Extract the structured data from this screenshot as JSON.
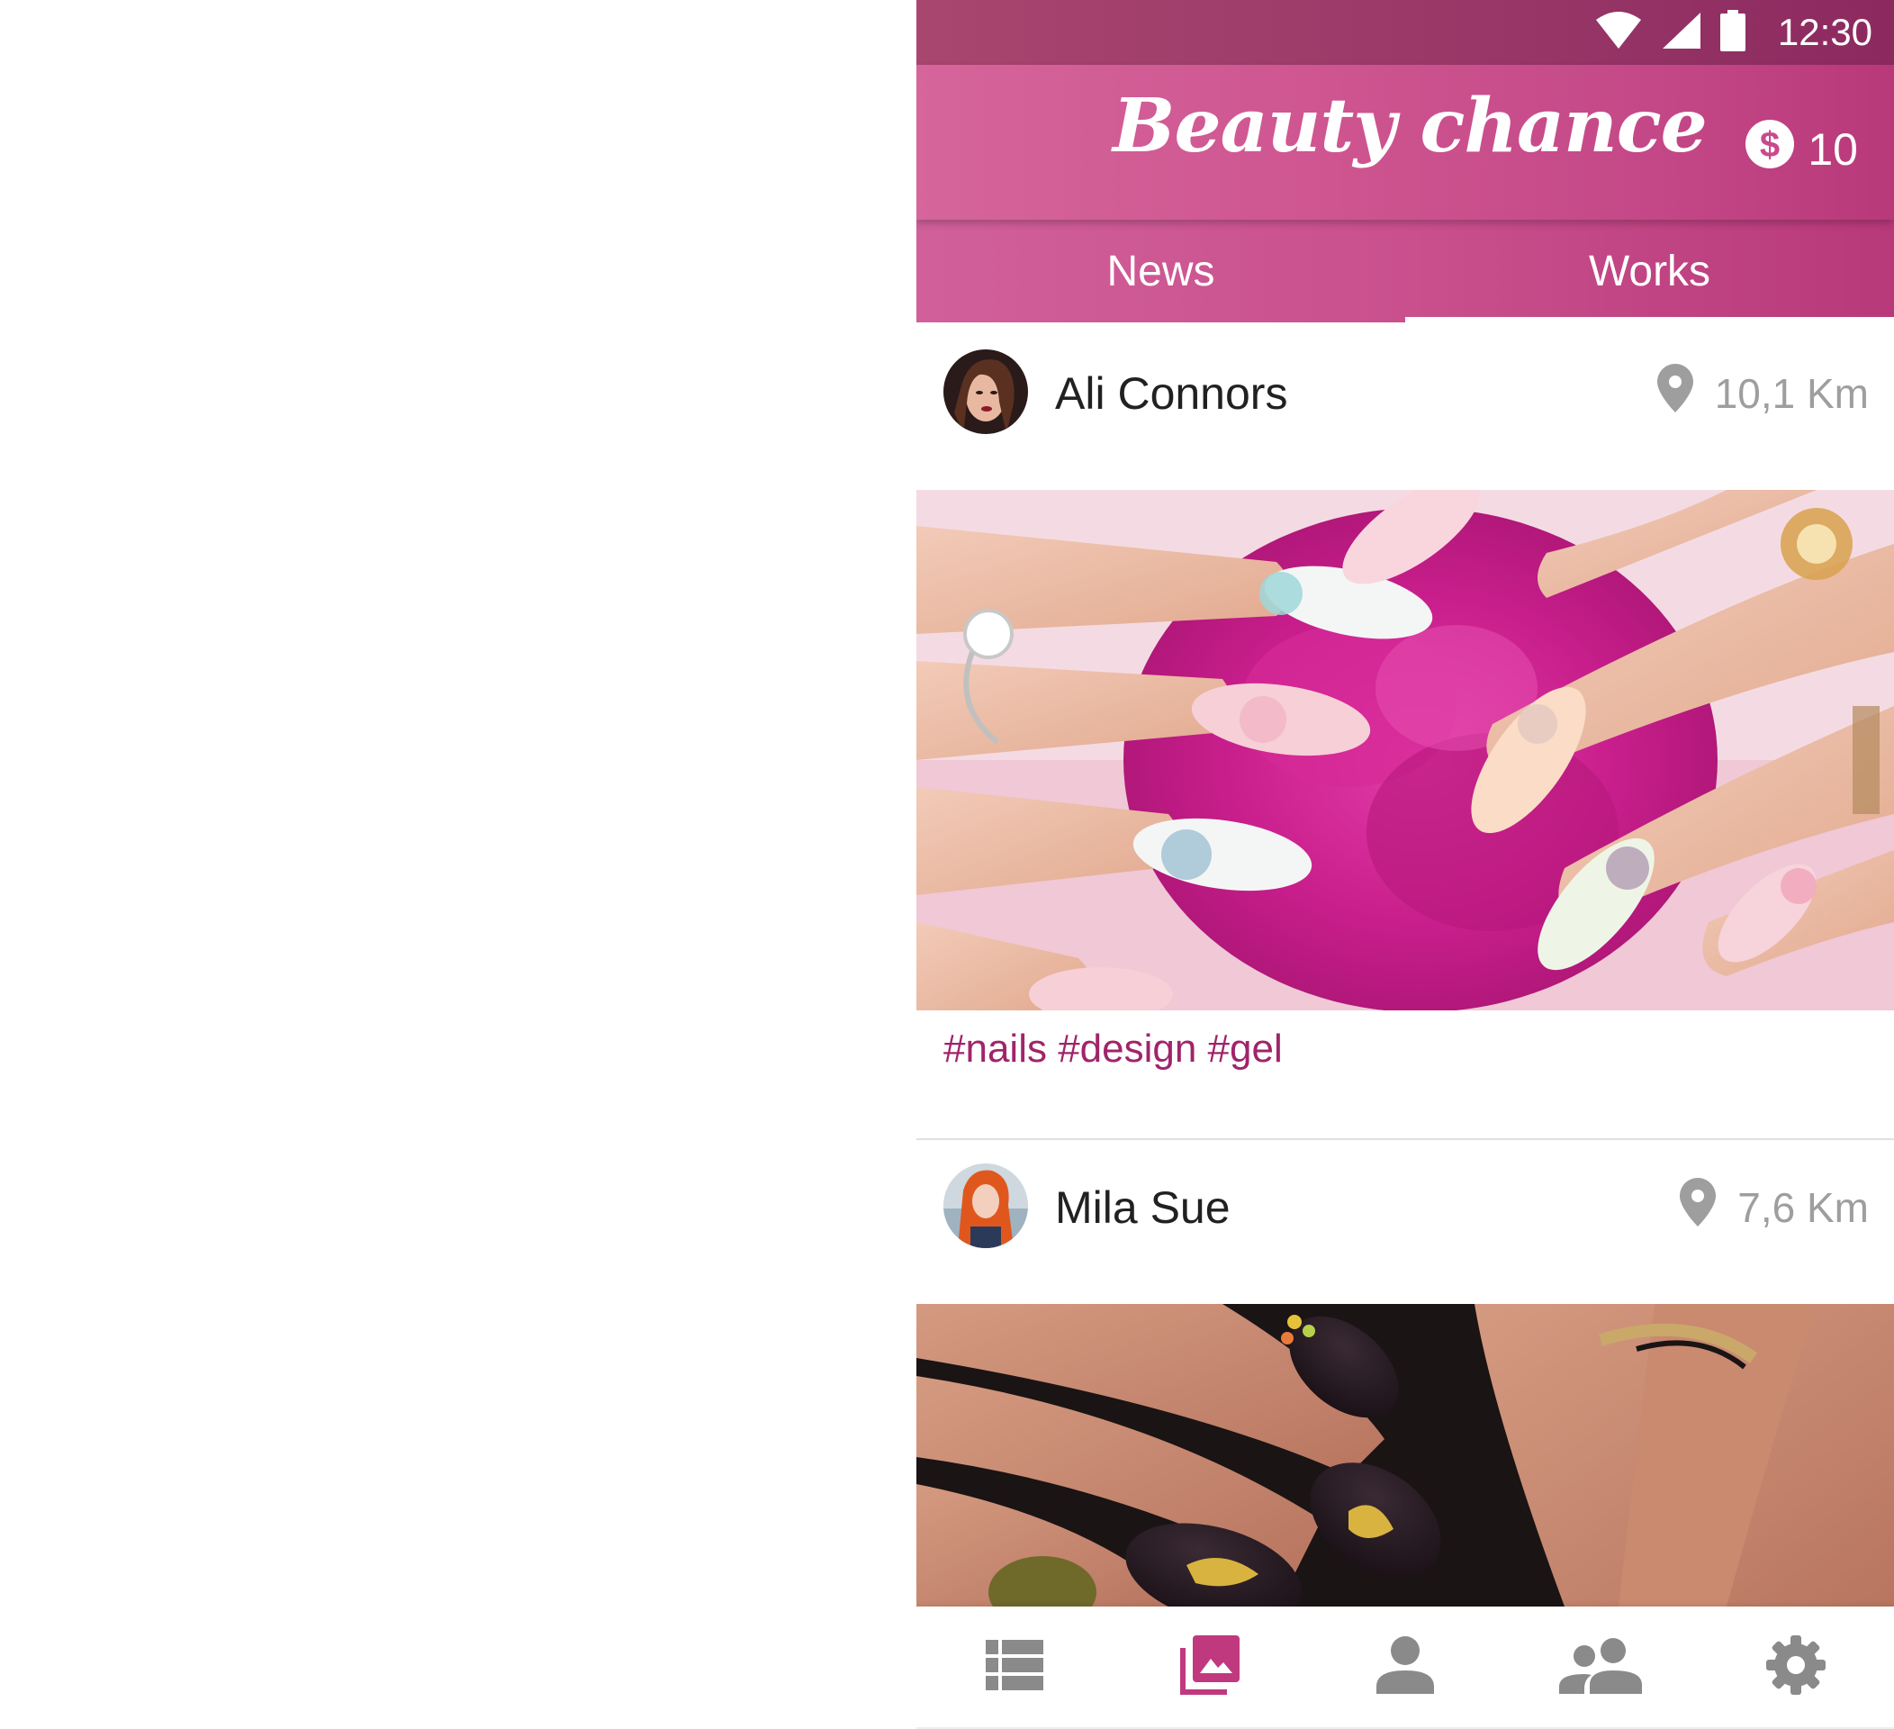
{
  "status_bar": {
    "time": "12:30",
    "icons": [
      "wifi-icon",
      "cellular-signal-icon",
      "battery-icon"
    ]
  },
  "app_bar": {
    "title": "Beauty chance",
    "coins_count": "10",
    "coins_icon": "dollar-coin-icon"
  },
  "tabs": [
    {
      "label": "News",
      "active": true
    },
    {
      "label": "Works",
      "active": false
    }
  ],
  "posts": [
    {
      "author": "Ali Connors",
      "distance": "10,1 Km",
      "hashtags": "#nails #design #gel",
      "image": "nail-art-photo-pink-rhinestones"
    },
    {
      "author": "Mila Sue",
      "distance": "7,6 Km",
      "image": "nail-art-photo-dark-purple-gold"
    }
  ],
  "bottom_nav": [
    {
      "icon": "list-icon",
      "active": false
    },
    {
      "icon": "gallery-icon",
      "active": true
    },
    {
      "icon": "person-icon",
      "active": false
    },
    {
      "icon": "people-icon",
      "active": false
    },
    {
      "icon": "settings-gear-icon",
      "active": false
    }
  ],
  "colors": {
    "brand_pink": "#c9508d",
    "status_bar": "#9b3a69",
    "hashtag": "#a0246a",
    "nav_active": "#c0397e",
    "nav_inactive": "#8a8a8a",
    "text_secondary": "#9e9e9e"
  }
}
